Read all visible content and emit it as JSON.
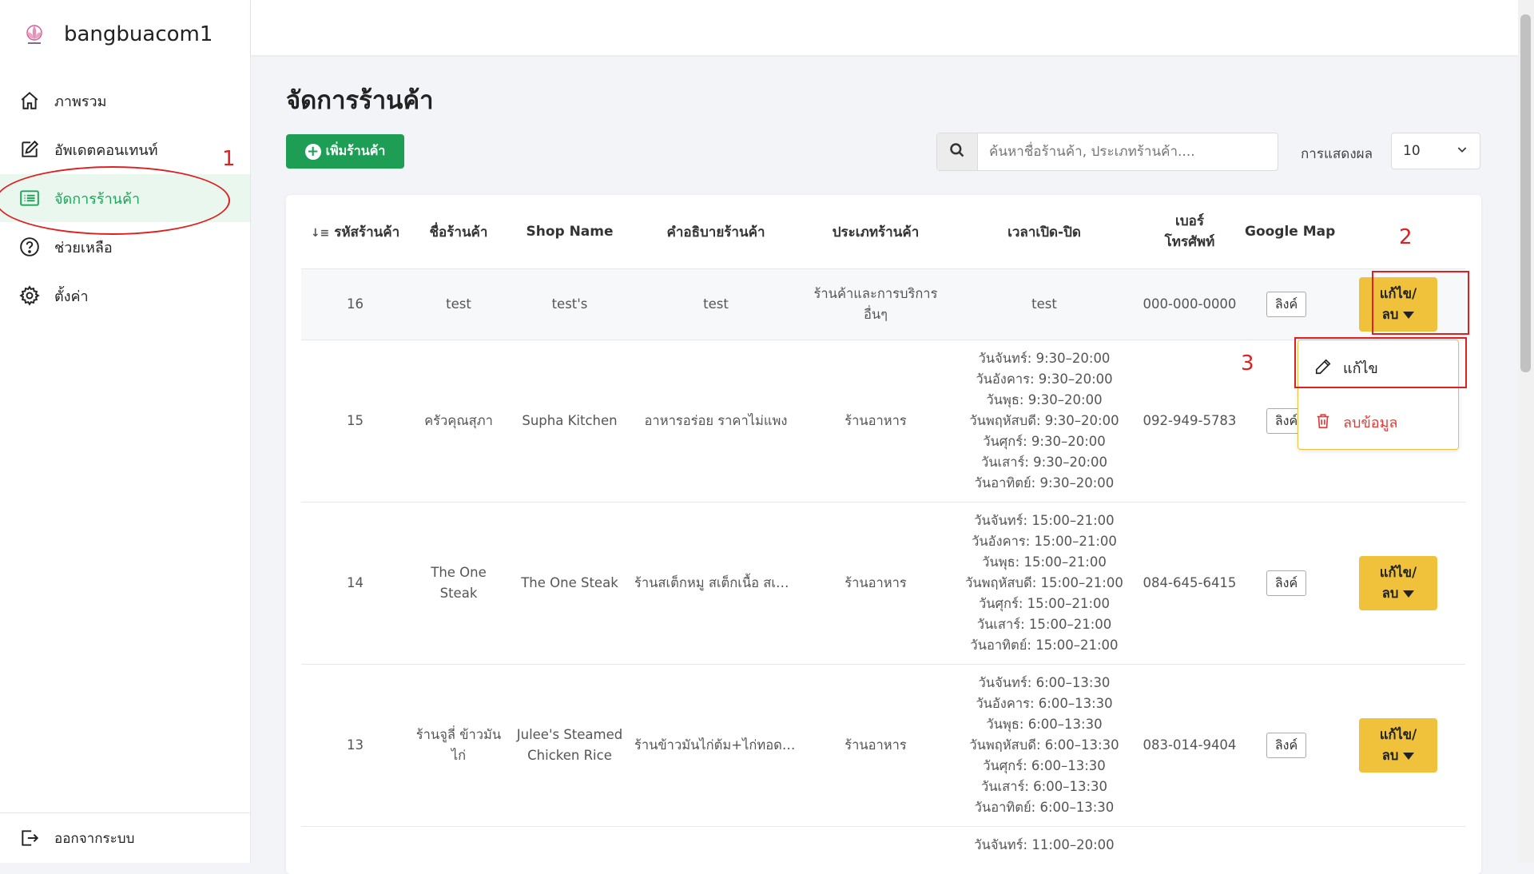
{
  "brand": {
    "name": "bangbuacom1"
  },
  "sidebar": {
    "items": [
      {
        "label": "ภาพรวม",
        "icon": "home-icon"
      },
      {
        "label": "อัพเดตคอนเทนท์",
        "icon": "edit-icon"
      },
      {
        "label": "จัดการร้านค้า",
        "icon": "list-icon"
      },
      {
        "label": "ช่วยเหลือ",
        "icon": "help-icon"
      },
      {
        "label": "ตั้งค่า",
        "icon": "settings-icon"
      }
    ],
    "active_index": 2,
    "logout_label": "ออกจากระบบ"
  },
  "page": {
    "title": "จัดการร้านค้า"
  },
  "toolbar": {
    "add_label": "เพิ่มร้านค้า",
    "search_placeholder": "ค้นหาชื่อร้านค้า, ประเภทร้านค้า....",
    "show_label": "การแสดงผล",
    "page_size": "10"
  },
  "table": {
    "headers": [
      "รหัสร้านค้า",
      "ชื่อร้านค้า",
      "Shop Name",
      "คำอธิบายร้านค้า",
      "ประเภทร้านค้า",
      "เวลาเปิด-ปิด",
      "เบอร์โทรศัพท์",
      "Google Map",
      ""
    ],
    "link_label": "ลิงค์",
    "action_line1": "แก้ไข/",
    "action_line2": "ลบ",
    "rows": [
      {
        "id": "16",
        "name": "test",
        "shop_name": "test's",
        "description": "test",
        "type": "ร้านค้าและการบริการอื่นๆ",
        "hours": [
          "test"
        ],
        "phone": "000-000-0000"
      },
      {
        "id": "15",
        "name": "ครัวคุณสุภา",
        "shop_name": "Supha Kitchen",
        "description": "อาหารอร่อย ราคาไม่แพง",
        "type": "ร้านอาหาร",
        "hours": [
          "วันจันทร์: 9:30–20:00",
          "วันอังคาร: 9:30–20:00",
          "วันพุธ: 9:30–20:00",
          "วันพฤหัสบดี: 9:30–20:00",
          "วันศุกร์: 9:30–20:00",
          "วันเสาร์: 9:30–20:00",
          "วันอาทิตย์: 9:30–20:00"
        ],
        "phone": "092-949-5783"
      },
      {
        "id": "14",
        "name": "The One Steak",
        "shop_name": "The One Steak",
        "description": "ร้านสเต็กหมู สเต็กเนื้อ สเต็กปล...",
        "type": "ร้านอาหาร",
        "hours": [
          "วันจันทร์: 15:00–21:00",
          "วันอังคาร: 15:00–21:00",
          "วันพุธ: 15:00–21:00",
          "วันพฤหัสบดี: 15:00–21:00",
          "วันศุกร์: 15:00–21:00",
          "วันเสาร์: 15:00–21:00",
          "วันอาทิตย์: 15:00–21:00"
        ],
        "phone": "084-645-6415"
      },
      {
        "id": "13",
        "name": "ร้านจูลี่ ข้าวมันไก่",
        "shop_name": "Julee's Steamed Chicken Rice",
        "description": "ร้านข้าวมันไก่ต้ม+ไก่ทอด ข้าว...",
        "type": "ร้านอาหาร",
        "hours": [
          "วันจันทร์: 6:00–13:30",
          "วันอังคาร: 6:00–13:30",
          "วันพุธ: 6:00–13:30",
          "วันพฤหัสบดี: 6:00–13:30",
          "วันศุกร์: 6:00–13:30",
          "วันเสาร์: 6:00–13:30",
          "วันอาทิตย์: 6:00–13:30"
        ],
        "phone": "083-014-9404"
      },
      {
        "id": "",
        "name": "",
        "shop_name": "",
        "description": "",
        "type": "",
        "hours": [
          "วันจันทร์: 11:00–20:00"
        ],
        "phone": ""
      }
    ]
  },
  "dropdown": {
    "edit_label": "แก้ไข",
    "delete_label": "ลบข้อมูล"
  },
  "annotations": [
    "1",
    "2",
    "3"
  ],
  "colors": {
    "primary": "#1e9e54",
    "accent": "#f0c23b",
    "danger": "#e53935",
    "annotation": "#e02020"
  }
}
